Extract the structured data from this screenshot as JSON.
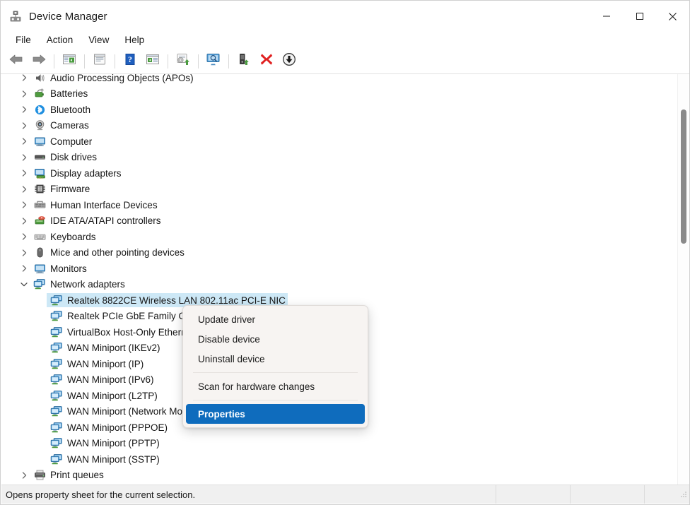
{
  "window": {
    "title": "Device Manager",
    "icon": "device-manager-icon",
    "caption": {
      "minimize": "minimize-icon",
      "maximize": "maximize-icon",
      "close": "close-icon"
    }
  },
  "menubar": {
    "items": [
      {
        "label": "File"
      },
      {
        "label": "Action"
      },
      {
        "label": "View"
      },
      {
        "label": "Help"
      }
    ]
  },
  "toolbar": {
    "buttons": [
      {
        "name": "back-button",
        "icon": "arrow-left-icon"
      },
      {
        "name": "forward-button",
        "icon": "arrow-right-icon"
      },
      {
        "name": "show-hide-console-tree-button",
        "icon": "console-tree-icon"
      },
      {
        "name": "properties-button",
        "icon": "properties-page-icon"
      },
      {
        "name": "help-button",
        "icon": "help-question-icon"
      },
      {
        "name": "show-window-in-taskbar-button",
        "icon": "window-list-icon"
      },
      {
        "name": "update-driver-button",
        "icon": "update-driver-gear-icon"
      },
      {
        "name": "scan-for-hardware-changes-button",
        "icon": "scan-hardware-monitor-icon"
      },
      {
        "name": "enable-device-button",
        "icon": "enable-device-icon"
      },
      {
        "name": "uninstall-device-button",
        "icon": "uninstall-red-x-icon"
      },
      {
        "name": "disable-device-button",
        "icon": "disable-device-down-arrow-icon"
      }
    ]
  },
  "tree": {
    "rows": [
      {
        "label": "Audio Processing Objects (APOs)",
        "level": 0,
        "expander": "collapsed",
        "icon": "speaker-icon",
        "selected": false
      },
      {
        "label": "Batteries",
        "level": 0,
        "expander": "collapsed",
        "icon": "battery-icon",
        "selected": false
      },
      {
        "label": "Bluetooth",
        "level": 0,
        "expander": "collapsed",
        "icon": "bluetooth-icon",
        "selected": false
      },
      {
        "label": "Cameras",
        "level": 0,
        "expander": "collapsed",
        "icon": "camera-icon",
        "selected": false
      },
      {
        "label": "Computer",
        "level": 0,
        "expander": "collapsed",
        "icon": "computer-icon",
        "selected": false
      },
      {
        "label": "Disk drives",
        "level": 0,
        "expander": "collapsed",
        "icon": "disk-drive-icon",
        "selected": false
      },
      {
        "label": "Display adapters",
        "level": 0,
        "expander": "collapsed",
        "icon": "display-adapter-icon",
        "selected": false
      },
      {
        "label": "Firmware",
        "level": 0,
        "expander": "collapsed",
        "icon": "firmware-chip-icon",
        "selected": false
      },
      {
        "label": "Human Interface Devices",
        "level": 0,
        "expander": "collapsed",
        "icon": "hid-icon",
        "selected": false
      },
      {
        "label": "IDE ATA/ATAPI controllers",
        "level": 0,
        "expander": "collapsed",
        "icon": "ide-controller-icon",
        "selected": false
      },
      {
        "label": "Keyboards",
        "level": 0,
        "expander": "collapsed",
        "icon": "keyboard-icon",
        "selected": false
      },
      {
        "label": "Mice and other pointing devices",
        "level": 0,
        "expander": "collapsed",
        "icon": "mouse-icon",
        "selected": false
      },
      {
        "label": "Monitors",
        "level": 0,
        "expander": "collapsed",
        "icon": "monitor-icon",
        "selected": false
      },
      {
        "label": "Network adapters",
        "level": 0,
        "expander": "expanded",
        "icon": "network-adapter-icon",
        "selected": false
      },
      {
        "label": "Realtek 8822CE Wireless LAN 802.11ac PCI-E NIC",
        "level": 1,
        "expander": "none",
        "icon": "network-adapter-icon",
        "selected": true
      },
      {
        "label": "Realtek PCIe GbE Family Controller",
        "level": 1,
        "expander": "none",
        "icon": "network-adapter-icon",
        "selected": false
      },
      {
        "label": "VirtualBox Host-Only Ethernet Adapter",
        "level": 1,
        "expander": "none",
        "icon": "network-adapter-icon",
        "selected": false
      },
      {
        "label": "WAN Miniport (IKEv2)",
        "level": 1,
        "expander": "none",
        "icon": "network-adapter-icon",
        "selected": false
      },
      {
        "label": "WAN Miniport (IP)",
        "level": 1,
        "expander": "none",
        "icon": "network-adapter-icon",
        "selected": false
      },
      {
        "label": "WAN Miniport (IPv6)",
        "level": 1,
        "expander": "none",
        "icon": "network-adapter-icon",
        "selected": false
      },
      {
        "label": "WAN Miniport (L2TP)",
        "level": 1,
        "expander": "none",
        "icon": "network-adapter-icon",
        "selected": false
      },
      {
        "label": "WAN Miniport (Network Monitor)",
        "level": 1,
        "expander": "none",
        "icon": "network-adapter-icon",
        "selected": false
      },
      {
        "label": "WAN Miniport (PPPOE)",
        "level": 1,
        "expander": "none",
        "icon": "network-adapter-icon",
        "selected": false
      },
      {
        "label": "WAN Miniport (PPTP)",
        "level": 1,
        "expander": "none",
        "icon": "network-adapter-icon",
        "selected": false
      },
      {
        "label": "WAN Miniport (SSTP)",
        "level": 1,
        "expander": "none",
        "icon": "network-adapter-icon",
        "selected": false
      },
      {
        "label": "Print queues",
        "level": 0,
        "expander": "collapsed",
        "icon": "printer-icon",
        "selected": false
      }
    ]
  },
  "context_menu": {
    "items": [
      {
        "label": "Update driver",
        "type": "item",
        "highlight": false
      },
      {
        "label": "Disable device",
        "type": "item",
        "highlight": false
      },
      {
        "label": "Uninstall device",
        "type": "item",
        "highlight": false
      },
      {
        "label": "",
        "type": "separator",
        "highlight": false
      },
      {
        "label": "Scan for hardware changes",
        "type": "item",
        "highlight": false
      },
      {
        "label": "",
        "type": "separator",
        "highlight": false
      },
      {
        "label": "Properties",
        "type": "item",
        "highlight": true
      }
    ]
  },
  "statusbar": {
    "message": "Opens property sheet for the current selection."
  },
  "colors": {
    "selection_blue": "#0f6cbd",
    "row_selection_fill": "#cde8f6",
    "menu_background": "#f7f4f2",
    "statusbar_background": "#f0f0f0",
    "scrollbar_thumb": "#8a8a8a",
    "uninstall_red": "#e02020"
  }
}
